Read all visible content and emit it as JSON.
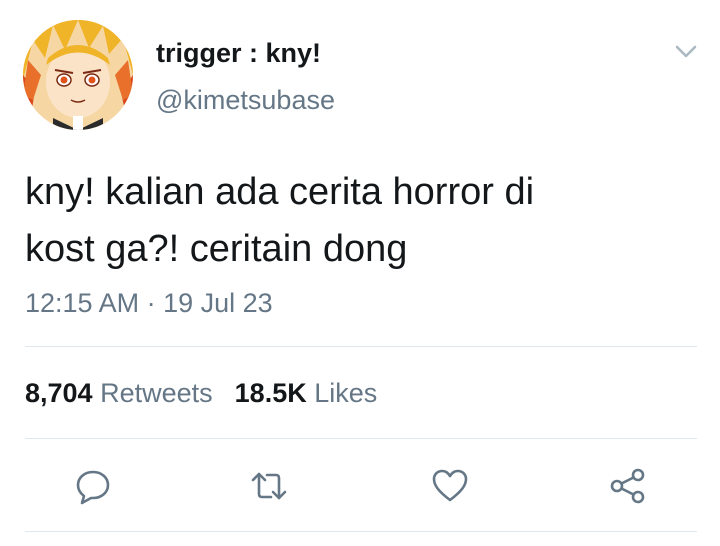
{
  "author": {
    "display_name": "trigger : kny!",
    "handle": "@kimetsubase"
  },
  "tweet": {
    "text_line1": "kny! kalian ada cerita horror di",
    "text_line2": "kost ga?! ceritain dong",
    "timestamp": "12:15 AM · 19 Jul 23"
  },
  "stats": {
    "retweets_count": "8,704",
    "retweets_label": "Retweets",
    "likes_count": "18.5K",
    "likes_label": "Likes"
  },
  "actions": [
    {
      "icon": "reply-icon"
    },
    {
      "icon": "retweet-icon"
    },
    {
      "icon": "heart-icon"
    },
    {
      "icon": "share-icon"
    }
  ],
  "colors": {
    "text": "#14171a",
    "secondary": "#657786",
    "divider": "#e1e8ed",
    "icon": "#657786"
  }
}
